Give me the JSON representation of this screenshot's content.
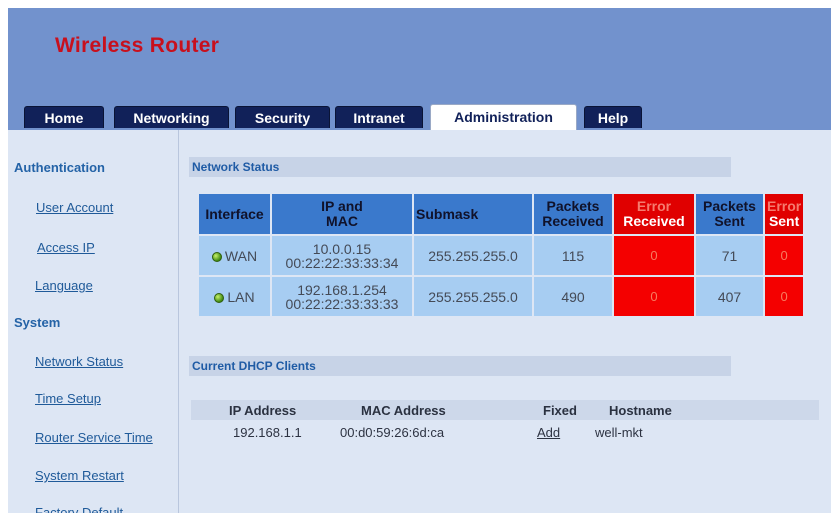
{
  "brand": "Wireless Router",
  "tabs": [
    {
      "label": "Home"
    },
    {
      "label": "Networking"
    },
    {
      "label": "Security"
    },
    {
      "label": "Intranet"
    },
    {
      "label": "Administration",
      "active": true
    },
    {
      "label": "Help"
    }
  ],
  "sidebar": {
    "sections": [
      {
        "heading": "Authentication",
        "items": [
          "User Account",
          "Access IP",
          "Language"
        ]
      },
      {
        "heading": "System",
        "items": [
          "Network Status",
          "Time Setup",
          "Router Service Time",
          "System Restart",
          "Factory Default"
        ]
      }
    ]
  },
  "network_status": {
    "title": "Network Status",
    "columns": {
      "interface": "Interface",
      "ip_mac_line1": "IP and",
      "ip_mac_line2": "MAC",
      "submask": "Submask",
      "packets_received_line1": "Packets",
      "packets_received_line2": "Received",
      "error_received_line1": "Error",
      "error_received_line2": "Received",
      "packets_sent_line1": "Packets",
      "packets_sent_line2": "Sent",
      "error_sent_line1": "Error",
      "error_sent_line2": "Sent"
    },
    "rows": [
      {
        "interface": "WAN",
        "ip": "10.0.0.15",
        "mac": "00:22:22:33:33:34",
        "submask": "255.255.255.0",
        "packets_received": "115",
        "error_received": "0",
        "packets_sent": "71",
        "error_sent": "0"
      },
      {
        "interface": "LAN",
        "ip": "192.168.1.254",
        "mac": "00:22:22:33:33:33",
        "submask": "255.255.255.0",
        "packets_received": "490",
        "error_received": "0",
        "packets_sent": "407",
        "error_sent": "0"
      }
    ]
  },
  "dhcp": {
    "title": "Current DHCP Clients",
    "columns": {
      "ip": "IP Address",
      "mac": "MAC Address",
      "fixed": "Fixed",
      "hostname": "Hostname"
    },
    "clients": [
      {
        "ip": "192.168.1.1",
        "mac": "00:d0:59:26:6d:ca",
        "fixed": "Add",
        "hostname": "well-mkt"
      }
    ]
  },
  "colors": {
    "header": "#7292cd",
    "brand": "#c8101d",
    "tab": "#112159",
    "table_header": "#3a79cc",
    "table_cell": "#a7cdf2",
    "error_cell": "#f40000"
  }
}
